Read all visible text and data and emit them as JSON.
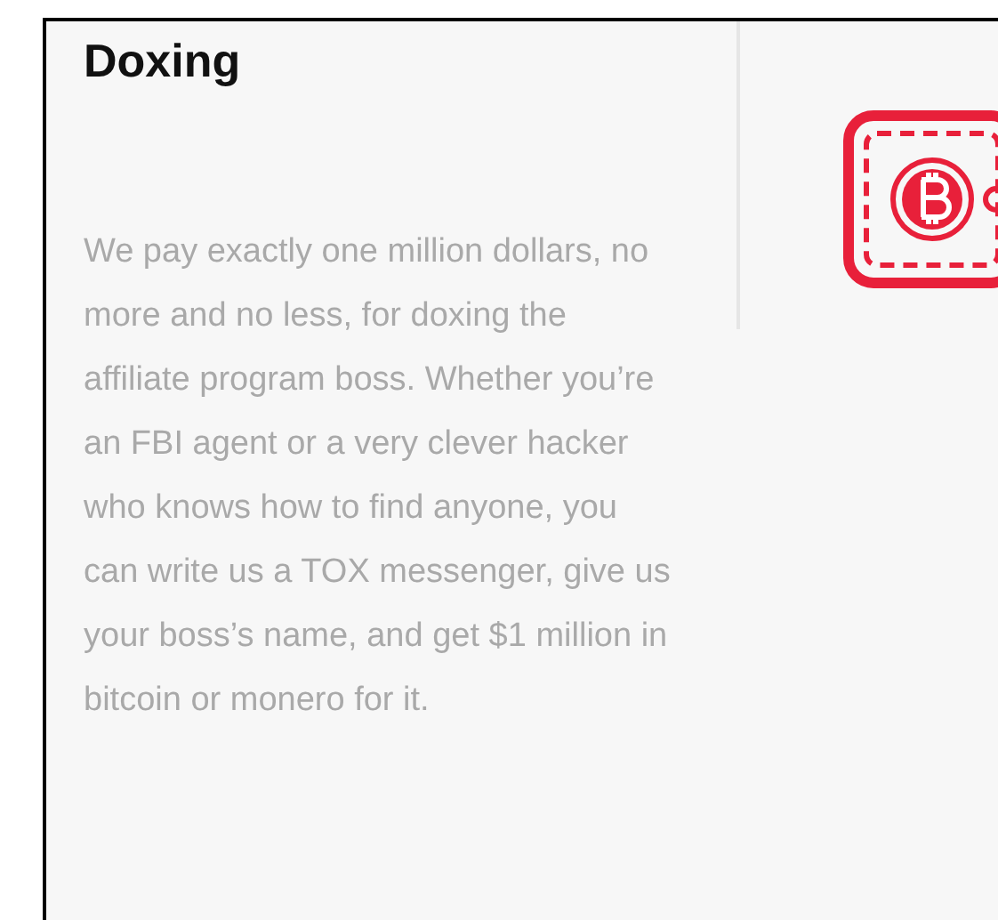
{
  "card": {
    "title": "Doxing",
    "description": "We pay exactly one million dollars, no more and no less, for doxing the affiliate program boss. Whether you’re an FBI agent or a very clever hacker who knows how to find anyone, you can write us a TOX messenger, give us your boss’s name, and get $1 million in bitcoin or monero for it."
  }
}
